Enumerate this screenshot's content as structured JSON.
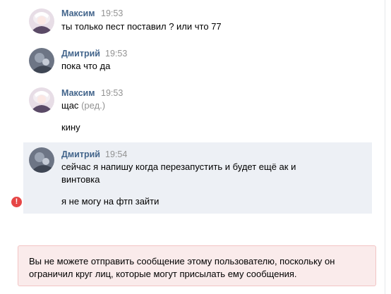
{
  "messages": [
    {
      "author": "Максим",
      "time": "19:53",
      "lines": [
        "ты только пест поставил ? или что 77"
      ]
    },
    {
      "author": "Дмитрий",
      "time": "19:53",
      "lines": [
        "пока что да"
      ]
    },
    {
      "author": "Максим",
      "time": "19:53",
      "lines": [
        "щас"
      ],
      "edited": "(ред.)",
      "extra": "кину"
    },
    {
      "author": "Дмитрий",
      "time": "19:54",
      "lines": [
        "сейчас я напишу когда перезапустить и будет ещё ак и",
        "винтовка"
      ],
      "extra": "я не могу на фтп зайти",
      "failed": true
    }
  ],
  "error_icon": "!",
  "notice": "Вы не можете отправить сообщение этому пользователю, поскольку он ограничил круг лиц, которые могут присылать ему сообщения.",
  "colors": {
    "author": "#42648b",
    "time": "#939393",
    "highlight": "#edf0f5",
    "error": "#e64646",
    "notice_bg": "#faebeb",
    "notice_border": "#f2c4c4"
  }
}
